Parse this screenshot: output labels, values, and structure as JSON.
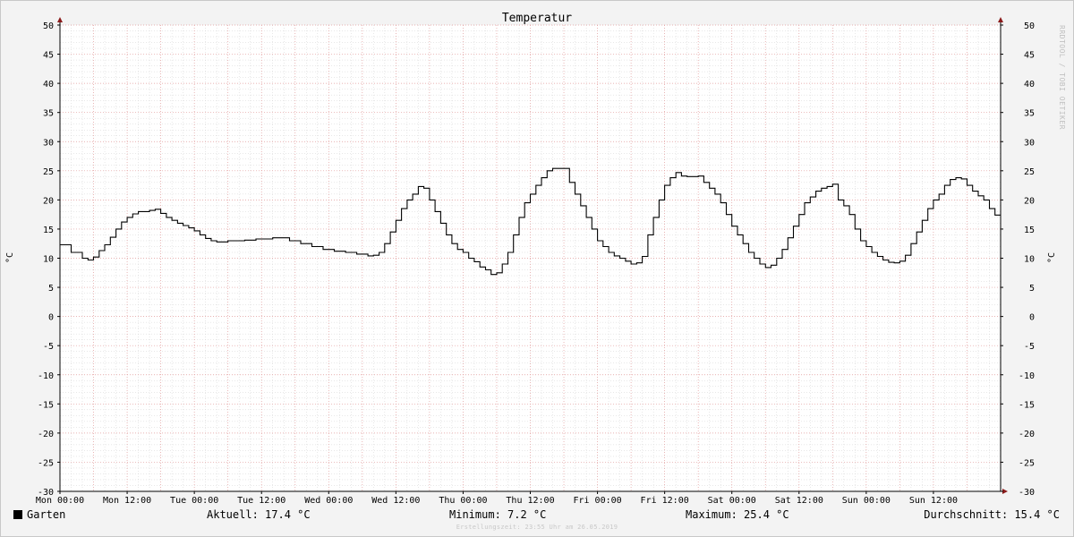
{
  "chart_data": {
    "type": "line",
    "title": "Temperatur",
    "ylabel": "°C",
    "ylabel_right": "°C",
    "ylim": [
      -30,
      50
    ],
    "y_ticks": [
      50,
      45,
      40,
      35,
      30,
      25,
      20,
      15,
      10,
      5,
      0,
      -5,
      -10,
      -15,
      -20,
      -25,
      -30
    ],
    "xlim_hours": [
      0,
      168
    ],
    "x_ticks": [
      {
        "hour": 0,
        "label": "Mon 00:00"
      },
      {
        "hour": 12,
        "label": "Mon 12:00"
      },
      {
        "hour": 24,
        "label": "Tue 00:00"
      },
      {
        "hour": 36,
        "label": "Tue 12:00"
      },
      {
        "hour": 48,
        "label": "Wed 00:00"
      },
      {
        "hour": 60,
        "label": "Wed 12:00"
      },
      {
        "hour": 72,
        "label": "Thu 00:00"
      },
      {
        "hour": 84,
        "label": "Thu 12:00"
      },
      {
        "hour": 96,
        "label": "Fri 00:00"
      },
      {
        "hour": 108,
        "label": "Fri 12:00"
      },
      {
        "hour": 120,
        "label": "Sat 00:00"
      },
      {
        "hour": 132,
        "label": "Sat 12:00"
      },
      {
        "hour": 144,
        "label": "Sun 00:00"
      },
      {
        "hour": 156,
        "label": "Sun 12:00"
      }
    ],
    "grid": true,
    "legend_position": "bottom-left",
    "series": [
      {
        "name": "Garten",
        "color": "#000000",
        "step": true,
        "points": [
          [
            0,
            12.3
          ],
          [
            2,
            11
          ],
          [
            4,
            10
          ],
          [
            5,
            9.7
          ],
          [
            6,
            10.2
          ],
          [
            7,
            11.3
          ],
          [
            8,
            12.3
          ],
          [
            9,
            13.6
          ],
          [
            10,
            15
          ],
          [
            11,
            16.2
          ],
          [
            12,
            17
          ],
          [
            13,
            17.6
          ],
          [
            14,
            18
          ],
          [
            15,
            18
          ],
          [
            16,
            18.2
          ],
          [
            17,
            18.4
          ],
          [
            18,
            17.7
          ],
          [
            19,
            17
          ],
          [
            20,
            16.5
          ],
          [
            21,
            16
          ],
          [
            22,
            15.6
          ],
          [
            23,
            15.2
          ],
          [
            24,
            14.7
          ],
          [
            25,
            14
          ],
          [
            26,
            13.4
          ],
          [
            27,
            13
          ],
          [
            28,
            12.8
          ],
          [
            29,
            12.8
          ],
          [
            30,
            13
          ],
          [
            31,
            13
          ],
          [
            33,
            13.1
          ],
          [
            35,
            13.3
          ],
          [
            38,
            13.5
          ],
          [
            41,
            13
          ],
          [
            43,
            12.5
          ],
          [
            45,
            12
          ],
          [
            47,
            11.5
          ],
          [
            49,
            11.2
          ],
          [
            51,
            11
          ],
          [
            53,
            10.7
          ],
          [
            55,
            10.4
          ],
          [
            56,
            10.5
          ],
          [
            57,
            11
          ],
          [
            58,
            12.5
          ],
          [
            59,
            14.5
          ],
          [
            60,
            16.5
          ],
          [
            61,
            18.5
          ],
          [
            62,
            20
          ],
          [
            63,
            21
          ],
          [
            64,
            22.3
          ],
          [
            65,
            22
          ],
          [
            66,
            20
          ],
          [
            67,
            18
          ],
          [
            68,
            16
          ],
          [
            69,
            14
          ],
          [
            70,
            12.5
          ],
          [
            71,
            11.5
          ],
          [
            72,
            11
          ],
          [
            73,
            10
          ],
          [
            74,
            9.4
          ],
          [
            75,
            8.5
          ],
          [
            76,
            8
          ],
          [
            77,
            7.2
          ],
          [
            78,
            7.5
          ],
          [
            79,
            9
          ],
          [
            80,
            11
          ],
          [
            81,
            14
          ],
          [
            82,
            17
          ],
          [
            83,
            19.5
          ],
          [
            84,
            21
          ],
          [
            85,
            22.5
          ],
          [
            86,
            23.8
          ],
          [
            87,
            25
          ],
          [
            88,
            25.4
          ],
          [
            90,
            25.4
          ],
          [
            91,
            23
          ],
          [
            92,
            21
          ],
          [
            93,
            19
          ],
          [
            94,
            17
          ],
          [
            95,
            15
          ],
          [
            96,
            13
          ],
          [
            97,
            12
          ],
          [
            98,
            11
          ],
          [
            99,
            10.4
          ],
          [
            100,
            10
          ],
          [
            101,
            9.5
          ],
          [
            102,
            9
          ],
          [
            103,
            9.2
          ],
          [
            104,
            10.3
          ],
          [
            105,
            14
          ],
          [
            106,
            17
          ],
          [
            107,
            20
          ],
          [
            108,
            22.5
          ],
          [
            109,
            23.8
          ],
          [
            110,
            24.7
          ],
          [
            111,
            24.1
          ],
          [
            112,
            24
          ],
          [
            114,
            24.1
          ],
          [
            115,
            23
          ],
          [
            116,
            22
          ],
          [
            117,
            21
          ],
          [
            118,
            19.5
          ],
          [
            119,
            17.5
          ],
          [
            120,
            15.5
          ],
          [
            121,
            14
          ],
          [
            122,
            12.5
          ],
          [
            123,
            11
          ],
          [
            124,
            10
          ],
          [
            125,
            9
          ],
          [
            126,
            8.4
          ],
          [
            127,
            8.8
          ],
          [
            128,
            10
          ],
          [
            129,
            11.5
          ],
          [
            130,
            13.5
          ],
          [
            131,
            15.5
          ],
          [
            132,
            17.5
          ],
          [
            133,
            19.5
          ],
          [
            134,
            20.5
          ],
          [
            135,
            21.5
          ],
          [
            136,
            22
          ],
          [
            137,
            22.3
          ],
          [
            138,
            22.7
          ],
          [
            139,
            20
          ],
          [
            140,
            19
          ],
          [
            141,
            17.5
          ],
          [
            142,
            15
          ],
          [
            143,
            13
          ],
          [
            144,
            12
          ],
          [
            145,
            11
          ],
          [
            146,
            10.3
          ],
          [
            147,
            9.7
          ],
          [
            148,
            9.3
          ],
          [
            149,
            9.2
          ],
          [
            150,
            9.5
          ],
          [
            151,
            10.5
          ],
          [
            152,
            12.5
          ],
          [
            153,
            14.5
          ],
          [
            154,
            16.5
          ],
          [
            155,
            18.5
          ],
          [
            156,
            20
          ],
          [
            157,
            21
          ],
          [
            158,
            22.5
          ],
          [
            159,
            23.5
          ],
          [
            160,
            23.8
          ],
          [
            161,
            23.6
          ],
          [
            162,
            22.5
          ],
          [
            163,
            21.5
          ],
          [
            164,
            20.7
          ],
          [
            165,
            20
          ],
          [
            166,
            18.5
          ],
          [
            167,
            17.4
          ],
          [
            168,
            17.4
          ]
        ]
      }
    ]
  },
  "legend": {
    "label": "Garten",
    "color": "#000000"
  },
  "stats": {
    "current": "Aktuell: 17.4 °C",
    "minimum": "Minimum: 7.2 °C",
    "maximum": "Maximum: 25.4 °C",
    "average": "Durchschnitt: 15.4 °C"
  },
  "credit": "Erstellungszeit: 23:55 Uhr am 26.05.2019",
  "watermark": "RRDTOOL / TOBI OETIKER",
  "colors": {
    "background": "#f3f3f3",
    "plot": "#ffffff",
    "major_grid": "#e09898",
    "minor_grid": "#d0d0d0",
    "arrow": "#8b1a1a"
  }
}
